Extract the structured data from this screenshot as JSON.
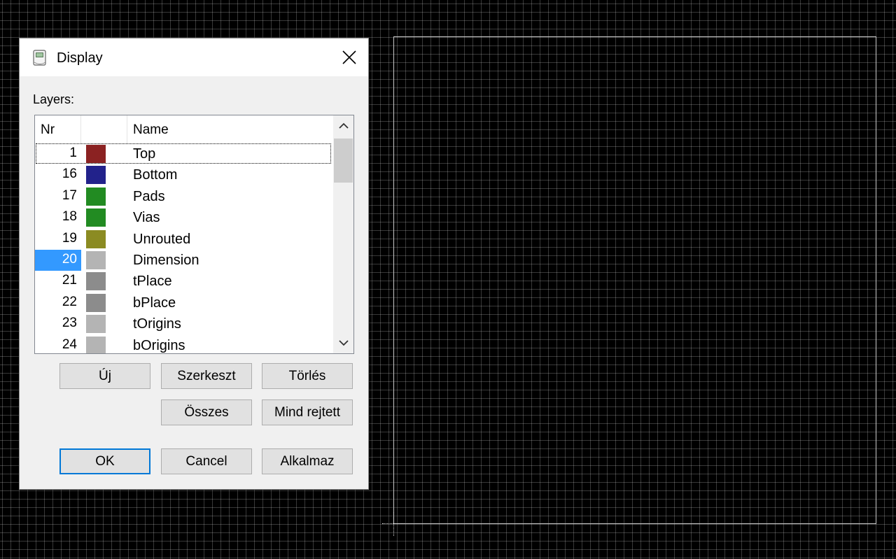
{
  "dialog": {
    "title": "Display",
    "layers_label": "Layers:",
    "columns": {
      "nr": "Nr",
      "color": "",
      "name": "Name"
    },
    "layers": [
      {
        "nr": "1",
        "name": "Top",
        "color": "#8b2222",
        "focused": true
      },
      {
        "nr": "16",
        "name": "Bottom",
        "color": "#22228b"
      },
      {
        "nr": "17",
        "name": "Pads",
        "color": "#228b22"
      },
      {
        "nr": "18",
        "name": "Vias",
        "color": "#228b22"
      },
      {
        "nr": "19",
        "name": "Unrouted",
        "color": "#8b8b22"
      },
      {
        "nr": "20",
        "name": "Dimension",
        "color": "#b4b4b4",
        "selected": true
      },
      {
        "nr": "21",
        "name": "tPlace",
        "color": "#8c8c8c"
      },
      {
        "nr": "22",
        "name": "bPlace",
        "color": "#8c8c8c"
      },
      {
        "nr": "23",
        "name": "tOrigins",
        "color": "#b4b4b4"
      },
      {
        "nr": "24",
        "name": "bOrigins",
        "color": "#b4b4b4"
      }
    ],
    "buttons": {
      "new": "Új",
      "edit": "Szerkeszt",
      "delete": "Törlés",
      "all": "Összes",
      "hide_all": "Mind rejtett",
      "ok": "OK",
      "cancel": "Cancel",
      "apply": "Alkalmaz"
    }
  },
  "colors": {
    "selection": "#3399ff",
    "default_button_border": "#0078d7",
    "canvas_background": "#000000",
    "grid_line": "#3a3a3a"
  }
}
